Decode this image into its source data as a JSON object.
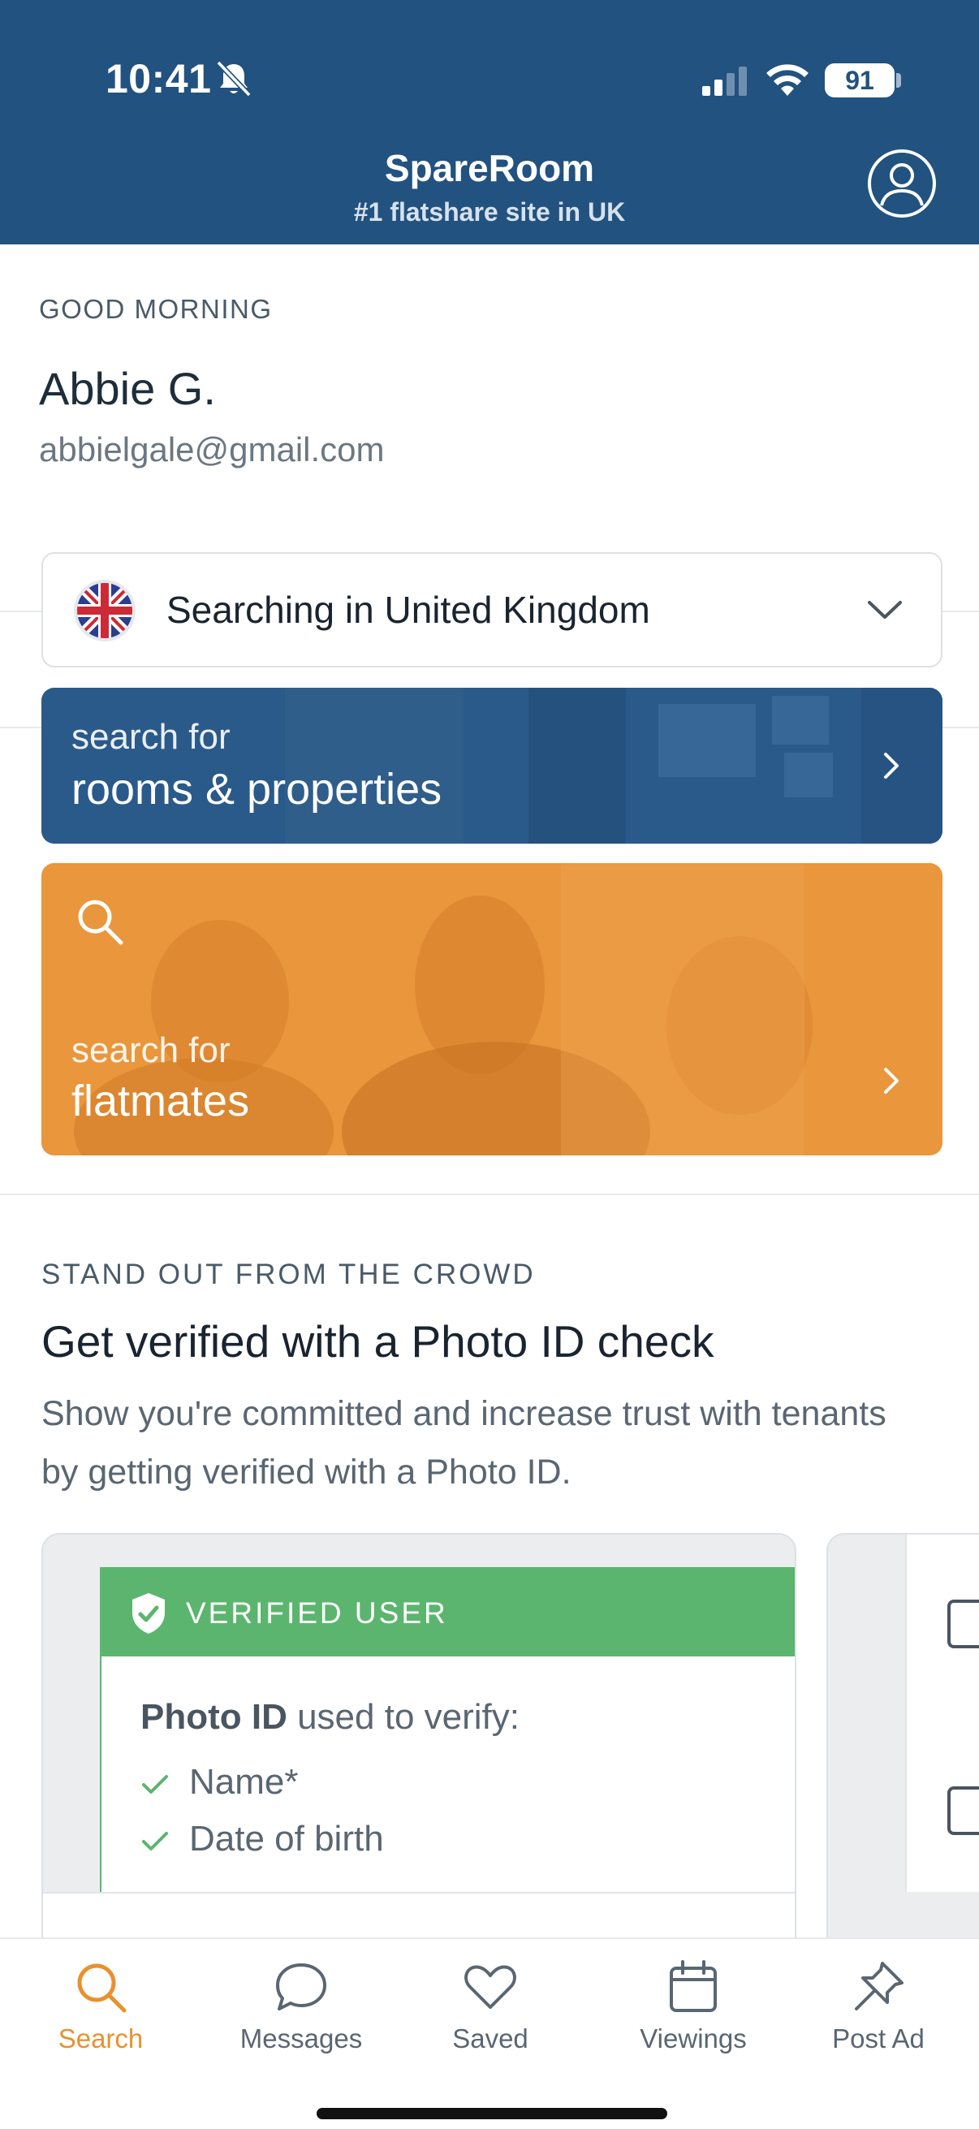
{
  "status_bar": {
    "time": "10:41",
    "battery": "91"
  },
  "header": {
    "title": "SpareRoom",
    "subtitle": "#1 flatshare site in UK"
  },
  "greeting": {
    "label": "GOOD MORNING",
    "name": "Abbie G.",
    "email": "abbielgale@gmail.com"
  },
  "country_selector": {
    "text": "Searching in United Kingdom",
    "flag": "uk-flag-icon"
  },
  "search_rooms": {
    "small": "search for",
    "big": "rooms & properties"
  },
  "search_flatmates": {
    "small": "search for",
    "big": "flatmates"
  },
  "stand_out": {
    "label": "STAND OUT FROM THE CROWD",
    "title": "Get verified with a Photo ID check",
    "description": "Show you're committed and increase trust with tenants by getting verified with a Photo ID."
  },
  "verified_card": {
    "badge": "VERIFIED USER",
    "photo_id_bold": "Photo ID",
    "photo_id_rest": " used to verify:",
    "checks": [
      "Name*",
      "Date of birth"
    ]
  },
  "bottom_nav": {
    "items": [
      {
        "label": "Search",
        "icon": "search-icon",
        "active": true
      },
      {
        "label": "Messages",
        "icon": "chat-bubble-icon",
        "active": false
      },
      {
        "label": "Saved",
        "icon": "heart-icon",
        "active": false
      },
      {
        "label": "Viewings",
        "icon": "calendar-icon",
        "active": false
      },
      {
        "label": "Post Ad",
        "icon": "pin-icon",
        "active": false
      }
    ]
  },
  "colors": {
    "header": "#22527f",
    "accent": "#e8912e",
    "verified": "#5cb56e",
    "rooms_card": "#2a5a8a",
    "flatmates_card": "#e9963c"
  }
}
